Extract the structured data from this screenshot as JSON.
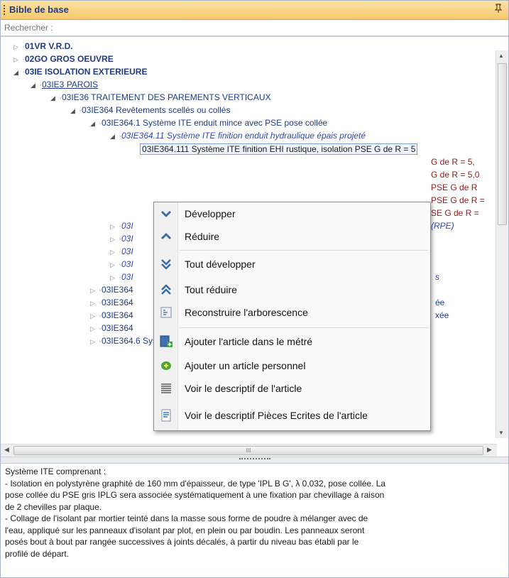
{
  "panel": {
    "title": "Bible de base",
    "pin_icon": "pin-icon"
  },
  "search": {
    "placeholder": "Rechercher :"
  },
  "tree": {
    "n1": "01VR V.R.D.",
    "n2": "02GO GROS OEUVRE",
    "n3": "03IE ISOLATION EXTERIEURE",
    "n4": "03IE3 PAROIS",
    "n5": "03IE36 TRAITEMENT DES PAREMENTS VERTICAUX",
    "n6": "03IE364 Revêtements scellés ou collés",
    "n7": "03IE364.1 Système ITE enduit mince avec PSE pose collée",
    "n8": "03IE364.11 Système ITE finition enduit hydraulique épais projeté",
    "n9": "03IE364.111 Système ITE finition EHI rustique, isolation PSE G de R = 5",
    "r1": "G de R = 5,",
    "r2": "G de R = 5,0",
    "r3": "PSE G de R",
    "r4": "PSE G de R =",
    "r5": "SE G de R =",
    "r6": "(RPE)",
    "i1": "03I",
    "i2": "03I",
    "i3": "03I",
    "i4": "03I",
    "i5": "03I",
    "i5tail": "s",
    "c1": "03IE364",
    "c2": "03IE364",
    "c2tail": "ée",
    "c3": "03IE364",
    "c3tail": "xée",
    "c4": "03IE364",
    "n_last": "03IE364.6 Système ITE enduit hydraulique avec PSE pose calée fixée"
  },
  "context_menu": {
    "items": [
      {
        "label": "Développer",
        "icon": "expand-chevron-icon"
      },
      {
        "label": "Réduire",
        "icon": "collapse-chevron-icon"
      },
      {
        "label": "Tout développer",
        "icon": "expand-all-icon"
      },
      {
        "label": "Tout réduire",
        "icon": "collapse-all-icon"
      },
      {
        "label": "Reconstruire l'arborescence",
        "icon": "rebuild-tree-icon"
      },
      {
        "label": "Ajouter l'article dans le métré",
        "icon": "add-to-estimate-icon"
      },
      {
        "label": "Ajouter un article personnel",
        "icon": "add-personal-article-icon"
      },
      {
        "label": "Voir le descriptif de l'article",
        "icon": "view-description-icon"
      },
      {
        "label": "Voir le descriptif Pièces Ecrites de l'article",
        "icon": "view-written-docs-icon"
      }
    ]
  },
  "scrollbar": {
    "h_thumb_glyph": "III"
  },
  "description": {
    "lines": [
      "Système ITE comprenant :",
      "- Isolation en polystyrène graphité de 160 mm d'épaisseur, de type 'IPL B G', λ 0,032, pose collée. La",
      "pose collée du PSE gris IPLG sera associée systématiquement à une fixation par chevillage à raison",
      "de 2 chevilles par plaque.",
      "- Collage de l'isolant par mortier teinté dans la masse sous forme de poudre à mélanger avec de",
      "l'eau, appliqué sur les panneaux d'isolant par plot, en plein ou par boudin. Les panneaux seront",
      "posés bout à bout par rangée successives à joints décalés, à partir du niveau bas établi par le",
      "profilé de départ."
    ]
  },
  "colors": {
    "title_bg": "#f7c96b",
    "title_text": "#1f3b86",
    "link_blue": "#1f3b86",
    "italic_blue": "#3347b5",
    "highlight_red": "#8b1d1d"
  }
}
